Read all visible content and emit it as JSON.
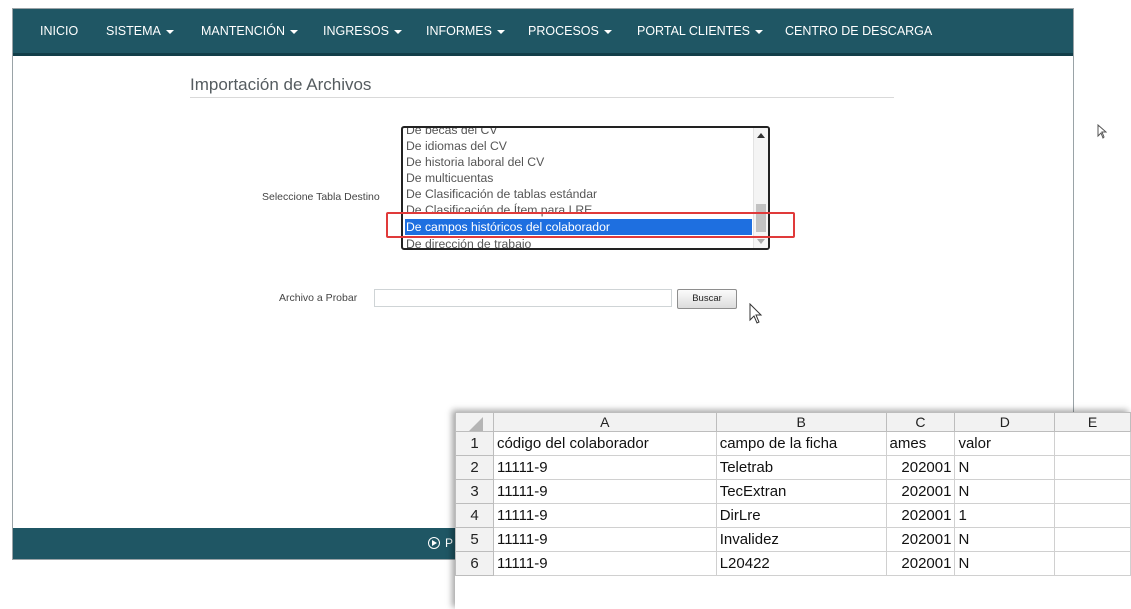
{
  "nav": {
    "items": [
      {
        "label": "INICIO",
        "caret": false
      },
      {
        "label": "SISTEMA",
        "caret": true
      },
      {
        "label": "MANTENCIÓN",
        "caret": true
      },
      {
        "label": "INGRESOS",
        "caret": true
      },
      {
        "label": "INFORMES",
        "caret": true
      },
      {
        "label": "PROCESOS",
        "caret": true
      },
      {
        "label": "PORTAL CLIENTES",
        "caret": true
      },
      {
        "label": "CENTRO DE DESCARGA",
        "caret": false
      }
    ]
  },
  "page": {
    "title": "Importación de Archivos"
  },
  "form": {
    "dest_label": "Seleccione Tabla Destino",
    "dest_options": [
      "De becas del CV",
      "De idiomas del CV",
      "De historia laboral del CV",
      "De multicuentas",
      "De Clasificación de tablas estándar",
      "De Clasificación de Ítem para LRE",
      "De campos históricos del colaborador",
      "De dirección de trabajo"
    ],
    "dest_selected": "De campos históricos del colaborador",
    "file_label": "Archivo a Probar",
    "file_value": "",
    "browse_label": "Buscar"
  },
  "footer": {
    "text": "P"
  },
  "colors": {
    "nav_bg": "#1f5664",
    "selection": "#1e6fe0",
    "highlight": "#e03a3a"
  },
  "spreadsheet": {
    "columns": [
      "A",
      "B",
      "C",
      "D",
      "E"
    ],
    "rows": [
      {
        "n": "1",
        "cells": [
          "código del colaborador",
          "campo de la ficha",
          "ames",
          "valor",
          ""
        ]
      },
      {
        "n": "2",
        "cells": [
          "11111-9",
          "Teletrab",
          "202001",
          "N",
          ""
        ]
      },
      {
        "n": "3",
        "cells": [
          "11111-9",
          "TecExtran",
          "202001",
          "N",
          ""
        ]
      },
      {
        "n": "4",
        "cells": [
          "11111-9",
          "DirLre",
          "202001",
          "1",
          ""
        ]
      },
      {
        "n": "5",
        "cells": [
          "11111-9",
          "Invalidez",
          "202001",
          "N",
          ""
        ]
      },
      {
        "n": "6",
        "cells": [
          "11111-9",
          "L20422",
          "202001",
          "N",
          ""
        ]
      }
    ]
  }
}
